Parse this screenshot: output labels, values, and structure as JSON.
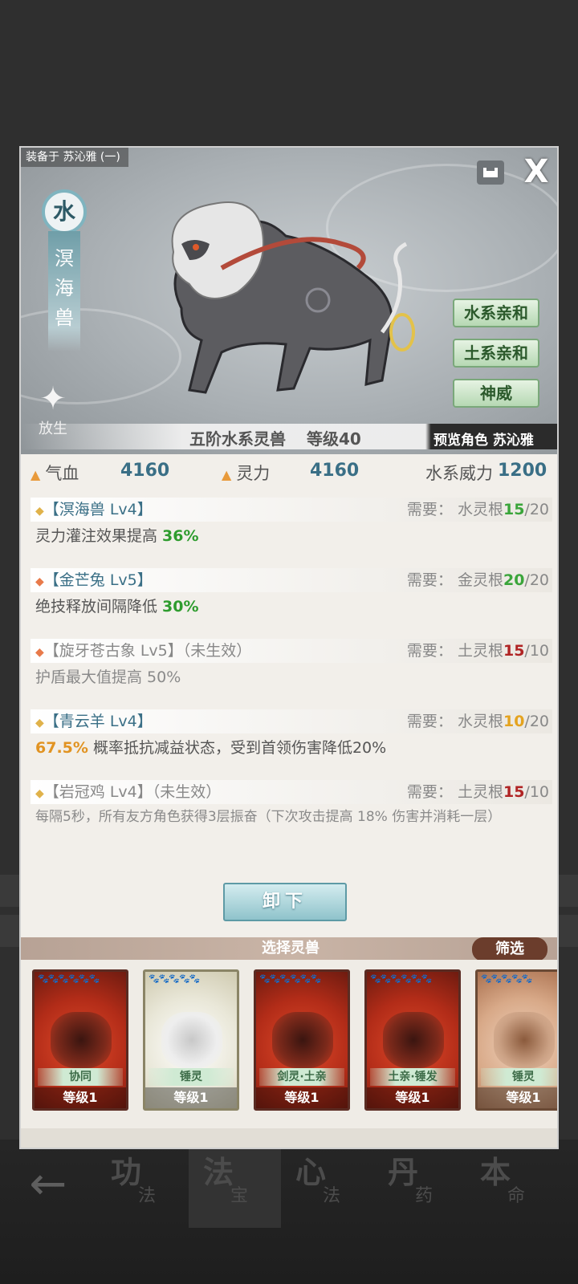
{
  "header": {
    "equipped_on": "装备于 苏沁雅 (一)",
    "close": "X"
  },
  "beast": {
    "element": "水",
    "name_chars": [
      "溟",
      "海",
      "兽"
    ],
    "release_label": "放生",
    "traits": [
      "水系亲和",
      "土系亲和",
      "神威"
    ],
    "tier_type": "五阶水系灵兽",
    "level": "等级40",
    "preview": "预览角色 苏沁雅"
  },
  "stats": {
    "hp_label": "气血",
    "hp_value": "4160",
    "spirit_label": "灵力",
    "spirit_value": "4160",
    "power_label": "水系威力",
    "power_value": "1200"
  },
  "skills": [
    {
      "title": "【溟海兽 Lv4】",
      "inactive": "",
      "req_label": "需要：",
      "req_root": "水灵根",
      "req_cur": "15",
      "req_max": "/20",
      "desc_pre": "灵力灌注效果提高 ",
      "desc_val": "36%",
      "desc_post": ""
    },
    {
      "title": "【金芒兔 Lv5】",
      "inactive": "",
      "req_label": "需要：",
      "req_root": "金灵根",
      "req_cur": "20",
      "req_max": "/20",
      "desc_pre": "绝技释放间隔降低 ",
      "desc_val": "30%",
      "desc_post": ""
    },
    {
      "title": "【旋牙苍古象 Lv5】",
      "inactive": "（未生效）",
      "req_label": "需要：",
      "req_root": "土灵根",
      "req_cur": "15",
      "req_max": "/10",
      "desc_pre": "护盾最大值提高 50%",
      "desc_val": "",
      "desc_post": ""
    },
    {
      "title": "【青云羊 Lv4】",
      "inactive": "",
      "req_label": "需要：",
      "req_root": "水灵根",
      "req_cur": "10",
      "req_max": "/20",
      "desc_pre": "",
      "desc_val": "67.5%",
      "desc_post": " 概率抵抗减益状态，受到首领伤害降低20%"
    },
    {
      "title": "【岩冠鸡 Lv4】",
      "inactive": "（未生效）",
      "req_label": "需要：",
      "req_root": "土灵根",
      "req_cur": "15",
      "req_max": "/10",
      "desc_pre": "每隔5秒，所有友方角色获得3层振奋（下次攻击提高 18% 伤害并消耗一层）",
      "desc_val": "",
      "desc_post": ""
    }
  ],
  "actions": {
    "unequip": "卸下",
    "select_title": "选择灵兽",
    "filter": "筛选"
  },
  "cards": [
    {
      "tag": "协同",
      "level": "等级1",
      "paws": "🐾🐾🐾🐾🐾🐾"
    },
    {
      "tag": "锤灵",
      "level": "等级1",
      "paws": "🐾🐾🐾🐾🐾"
    },
    {
      "tag": "剑灵·土亲",
      "level": "等级1",
      "paws": "🐾🐾🐾🐾🐾🐾"
    },
    {
      "tag": "土亲·锤发",
      "level": "等级1",
      "paws": "🐾🐾🐾🐾🐾🐾"
    },
    {
      "tag": "锤灵",
      "level": "等级1",
      "paws": "🐾🐾🐾🐾🐾"
    }
  ],
  "bottom_nav": [
    {
      "big": "功",
      "small": "法"
    },
    {
      "big": "法",
      "small": "宝"
    },
    {
      "big": "心",
      "small": "法"
    },
    {
      "big": "丹",
      "small": "药"
    },
    {
      "big": "本",
      "small": "命"
    }
  ],
  "colors": {
    "accent_blue": "#3a6f86",
    "ok_green": "#3aa53a",
    "bad_red": "#b02424",
    "warn_orange": "#e4a31f"
  }
}
